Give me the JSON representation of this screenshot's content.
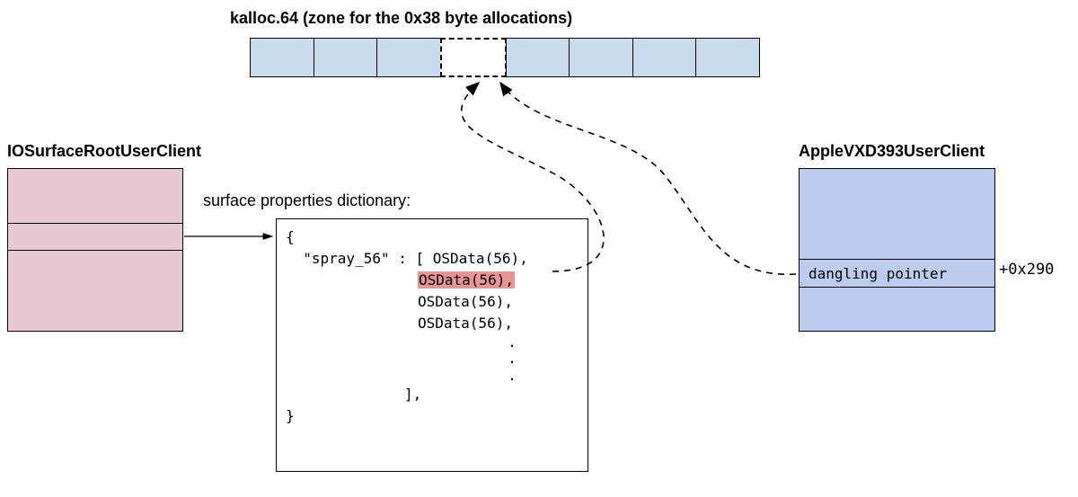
{
  "zone_title": "kalloc.64 (zone for the 0x38 byte allocations)",
  "zone_slots": 8,
  "zone_freed_index": 3,
  "iosurface_title": "IOSurfaceRootUserClient",
  "applevxd_title": "AppleVXD393UserClient",
  "applevxd_row_text": "dangling pointer",
  "applevxd_offset": "+0x290",
  "arrow_label": "surface properties dictionary:",
  "dict": {
    "open": "{",
    "key": "\"spray_56\" : [ ",
    "items": [
      "OSData(56),",
      "OSData(56),",
      "OSData(56),",
      "OSData(56),"
    ],
    "highlight_index": 1,
    "ellipsis": ".",
    "close_bracket": "],",
    "close": "}"
  }
}
